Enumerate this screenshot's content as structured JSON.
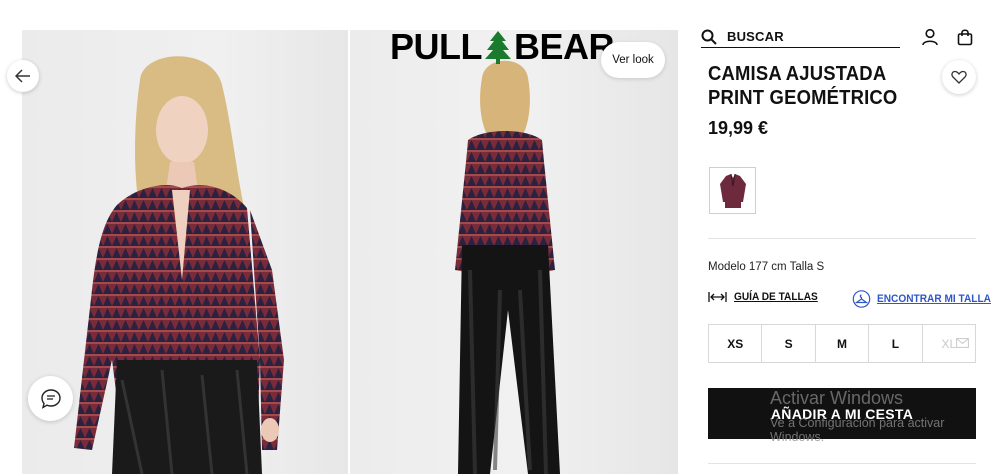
{
  "brand": {
    "logo_left": "PULL",
    "logo_right": "BEAR"
  },
  "gallery": {
    "ver_look": "Ver look"
  },
  "search": {
    "label": "BUSCAR"
  },
  "product": {
    "title": "CAMISA AJUSTADA PRINT GEOMÉTRICO",
    "price": "19,99 €",
    "model_info": "Modelo 177 cm Talla S"
  },
  "links": {
    "size_guide": "GUÍA DE TALLAS",
    "find_size": "ENCONTRAR MI TALLA"
  },
  "sizes": [
    {
      "label": "XS",
      "available": true
    },
    {
      "label": "S",
      "available": true
    },
    {
      "label": "M",
      "available": true
    },
    {
      "label": "L",
      "available": true
    },
    {
      "label": "XL",
      "available": false
    }
  ],
  "cart": {
    "add_label": "AÑADIR A MI CESTA"
  },
  "os_watermark": {
    "line1": "Activar Windows",
    "line2": "Ve a Configuración para activar",
    "line3": "Windows."
  },
  "colors": {
    "accent_link": "#2f57c9",
    "button_bg": "#111111",
    "shirt_primary": "#7a2b3a",
    "shirt_secondary": "#2a2240"
  }
}
